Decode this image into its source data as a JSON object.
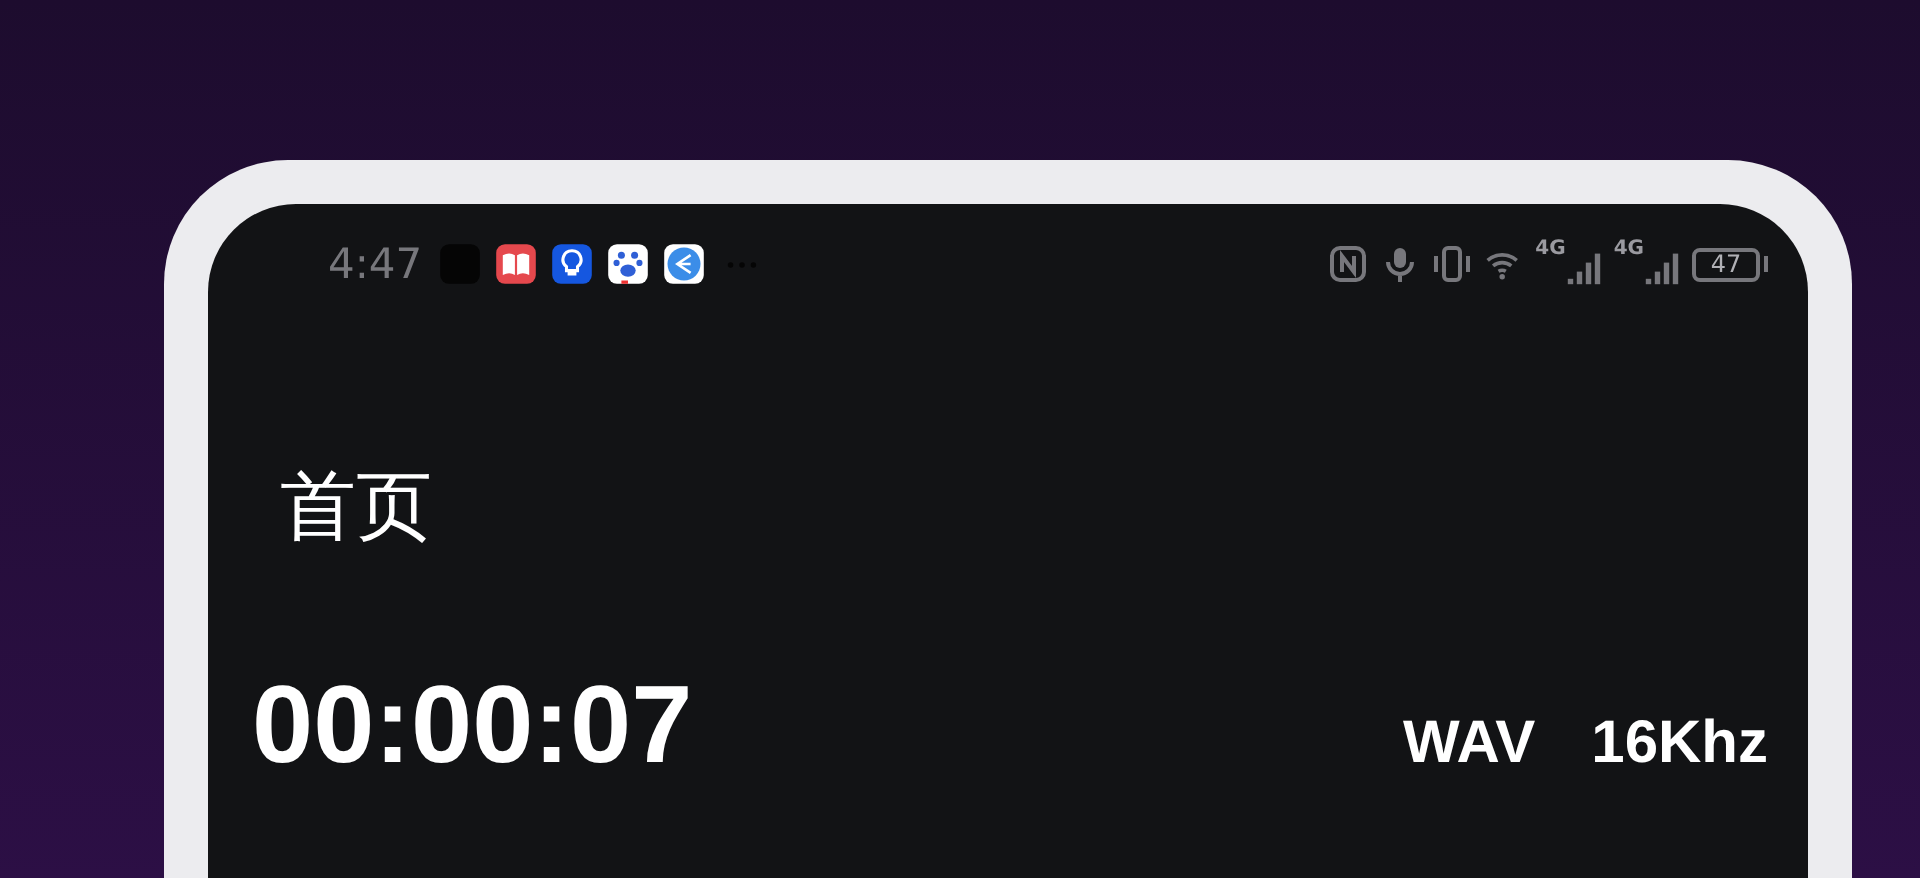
{
  "status_bar": {
    "time": "4:47",
    "network_labels": [
      "4G",
      "4G"
    ],
    "battery": "47"
  },
  "page_title": "首页",
  "recording": {
    "duration": "00:00:07",
    "format": "WAV",
    "sample_rate": "16Khz"
  }
}
